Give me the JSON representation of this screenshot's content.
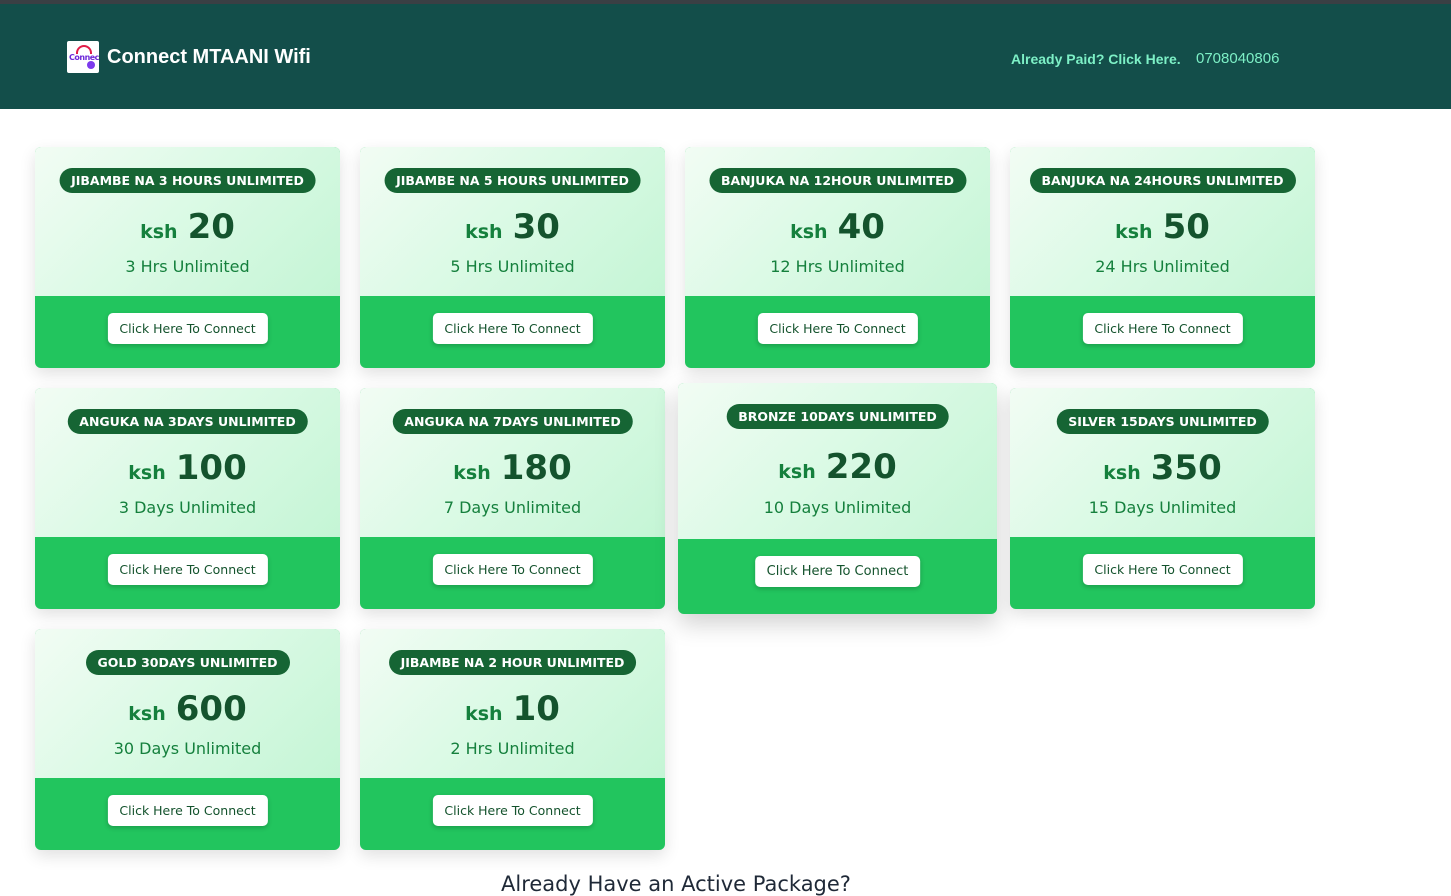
{
  "header": {
    "brand_name": "Connect MTAANI Wifi",
    "logo_text": "Connect",
    "paid_link": "Already Paid? Click Here.",
    "phone": "0708040806"
  },
  "packages": [
    {
      "name": "JIBAMBE NA 3 HOURS UNLIMITED",
      "currency": "ksh",
      "price": "20",
      "duration": "3 Hrs Unlimited",
      "button": "Click Here To Connect"
    },
    {
      "name": "JIBAMBE NA 5 HOURS UNLIMITED",
      "currency": "ksh",
      "price": "30",
      "duration": "5 Hrs Unlimited",
      "button": "Click Here To Connect"
    },
    {
      "name": "BANJUKA NA 12HOUR UNLIMITED",
      "currency": "ksh",
      "price": "40",
      "duration": "12 Hrs Unlimited",
      "button": "Click Here To Connect"
    },
    {
      "name": "BANJUKA NA 24HOURS UNLIMITED",
      "currency": "ksh",
      "price": "50",
      "duration": "24 Hrs Unlimited",
      "button": "Click Here To Connect"
    },
    {
      "name": "ANGUKA NA 3DAYS UNLIMITED",
      "currency": "ksh",
      "price": "100",
      "duration": "3 Days Unlimited",
      "button": "Click Here To Connect"
    },
    {
      "name": "ANGUKA NA 7DAYS UNLIMITED",
      "currency": "ksh",
      "price": "180",
      "duration": "7 Days Unlimited",
      "button": "Click Here To Connect"
    },
    {
      "name": "BRONZE 10DAYS UNLIMITED",
      "currency": "ksh",
      "price": "220",
      "duration": "10 Days Unlimited",
      "button": "Click Here To Connect"
    },
    {
      "name": "SILVER 15DAYS UNLIMITED",
      "currency": "ksh",
      "price": "350",
      "duration": "15 Days Unlimited",
      "button": "Click Here To Connect"
    },
    {
      "name": "GOLD 30DAYS UNLIMITED",
      "currency": "ksh",
      "price": "600",
      "duration": "30 Days Unlimited",
      "button": "Click Here To Connect"
    },
    {
      "name": "JIBAMBE NA 2 HOUR UNLIMITED",
      "currency": "ksh",
      "price": "10",
      "duration": "2 Hrs Unlimited",
      "button": "Click Here To Connect"
    }
  ],
  "footer": {
    "question": "Already Have an Active Package?"
  },
  "colors": {
    "header_bg": "#134e4a",
    "accent_green": "#22c55e",
    "pill_bg": "#166534",
    "link": "#7df0c6"
  }
}
